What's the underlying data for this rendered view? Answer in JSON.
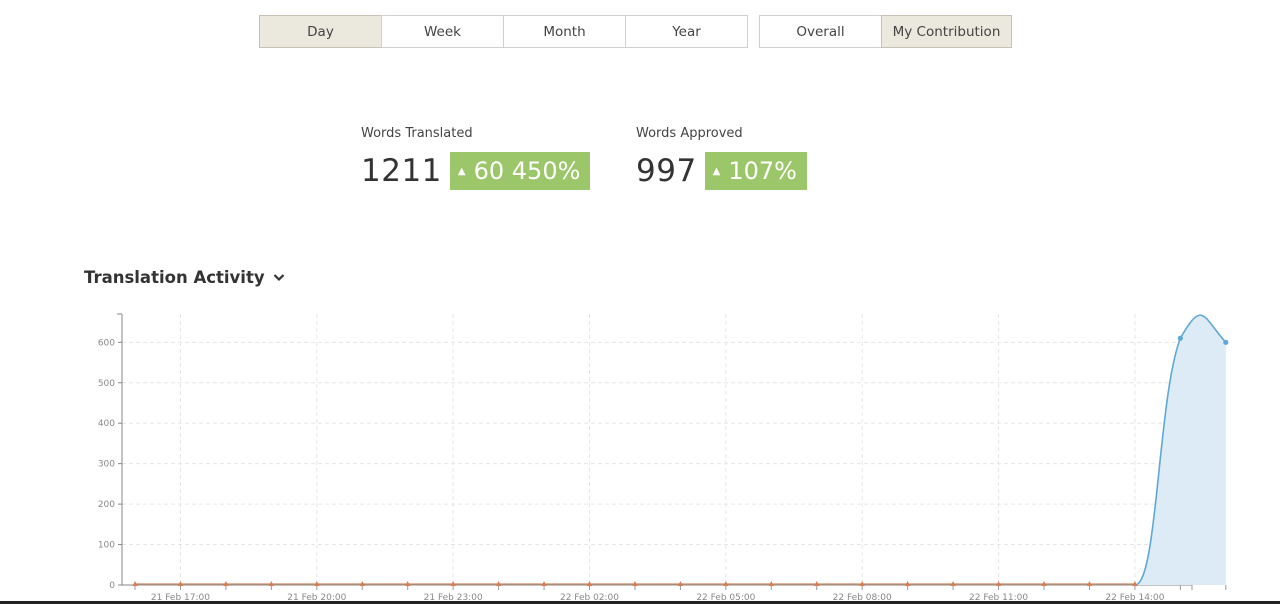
{
  "period_tabs": [
    {
      "label": "Day",
      "active": true
    },
    {
      "label": "Week",
      "active": false
    },
    {
      "label": "Month",
      "active": false
    },
    {
      "label": "Year",
      "active": false
    }
  ],
  "scope_tabs": [
    {
      "label": "Overall",
      "active": false
    },
    {
      "label": "My Contribution",
      "active": true
    }
  ],
  "stats": {
    "translated": {
      "label": "Words Translated",
      "value": "1211",
      "change": "60 450%"
    },
    "approved": {
      "label": "Words Approved",
      "value": "997",
      "change": "107%"
    }
  },
  "section": {
    "title": "Translation Activity"
  },
  "colors": {
    "accent": "#5fa8d6",
    "fill": "#dcebf6",
    "badge": "#9cc66a",
    "marker": "#e07a4a"
  },
  "chart_data": {
    "type": "area",
    "title": "",
    "xlabel": "",
    "ylabel": "",
    "ylim": [
      0,
      670
    ],
    "yticks": [
      0,
      100,
      200,
      300,
      400,
      500,
      600
    ],
    "xtick_labels": [
      "21 Feb 17:00",
      "21 Feb 20:00",
      "21 Feb 23:00",
      "22 Feb 02:00",
      "22 Feb 05:00",
      "22 Feb 08:00",
      "22 Feb 11:00",
      "22 Feb 14:00"
    ],
    "x": [
      "21 Feb 16:00",
      "21 Feb 17:00",
      "21 Feb 18:00",
      "21 Feb 19:00",
      "21 Feb 20:00",
      "21 Feb 21:00",
      "21 Feb 22:00",
      "21 Feb 23:00",
      "22 Feb 00:00",
      "22 Feb 01:00",
      "22 Feb 02:00",
      "22 Feb 03:00",
      "22 Feb 04:00",
      "22 Feb 05:00",
      "22 Feb 06:00",
      "22 Feb 07:00",
      "22 Feb 08:00",
      "22 Feb 09:00",
      "22 Feb 10:00",
      "22 Feb 11:00",
      "22 Feb 12:00",
      "22 Feb 13:00",
      "22 Feb 14:00",
      "22 Feb 15:00",
      "22 Feb 16:00"
    ],
    "series": [
      {
        "values": [
          0,
          0,
          0,
          0,
          0,
          0,
          0,
          0,
          0,
          0,
          0,
          0,
          0,
          0,
          0,
          0,
          0,
          0,
          0,
          0,
          0,
          0,
          0,
          610,
          600
        ]
      }
    ],
    "grid": true
  }
}
